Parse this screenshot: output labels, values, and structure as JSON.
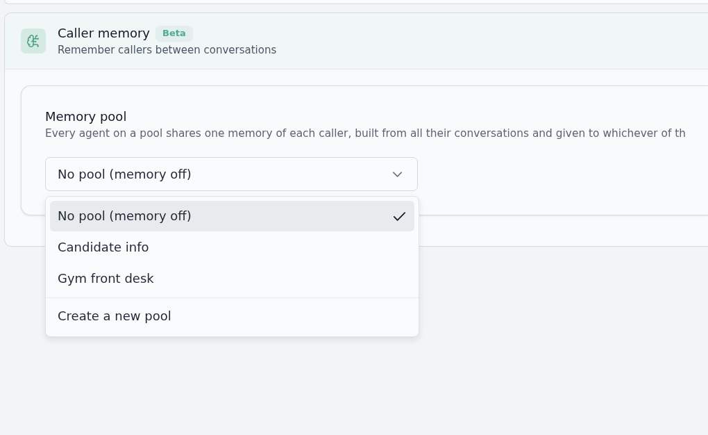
{
  "feature": {
    "title": "Caller memory",
    "badge": "Beta",
    "subtitle": "Remember callers between conversations"
  },
  "memory_pool": {
    "label": "Memory pool",
    "description": "Every agent on a pool shares one memory of each caller, built from all their conversations and given to whichever of th",
    "select": {
      "value": "No pool (memory off)",
      "expanded": true
    }
  },
  "menu": {
    "options": [
      {
        "label": "No pool (memory off)",
        "selected": true
      },
      {
        "label": "Candidate info",
        "selected": false
      },
      {
        "label": "Gym front desk",
        "selected": false
      }
    ],
    "create_action": "Create a new pool"
  }
}
